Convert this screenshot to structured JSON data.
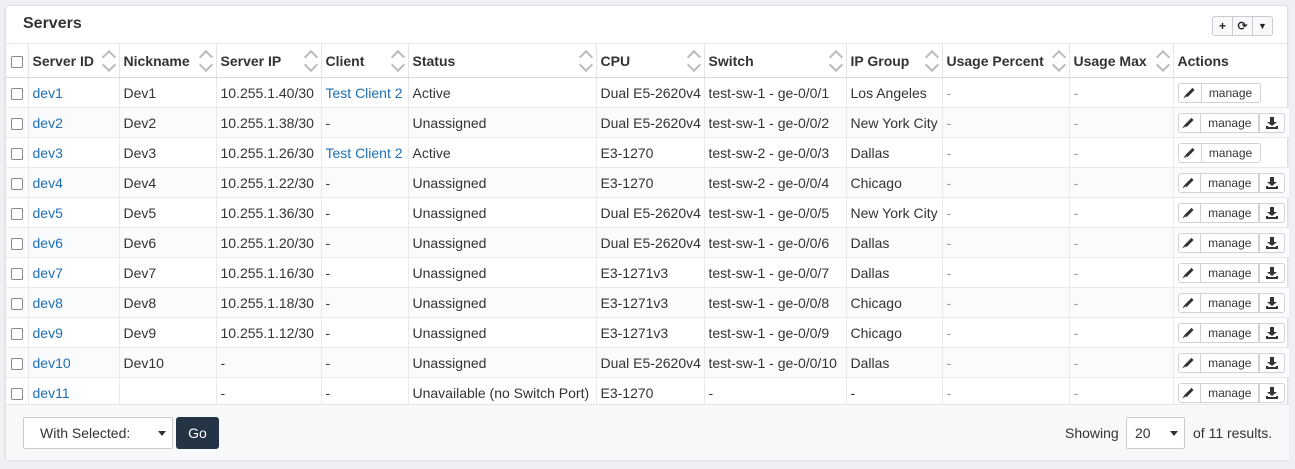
{
  "panel": {
    "title": "Servers"
  },
  "tools": [
    {
      "name": "add-icon",
      "glyph": "+"
    },
    {
      "name": "refresh-icon",
      "glyph": "⟳"
    },
    {
      "name": "filter-icon",
      "glyph": "▼"
    }
  ],
  "columns": [
    "Server ID",
    "Nickname",
    "Server IP",
    "Client",
    "Status",
    "CPU",
    "Switch",
    "IP Group",
    "Usage Percent",
    "Usage Max",
    "Actions"
  ],
  "rows": [
    {
      "id": "dev1",
      "nickname": "Dev1",
      "ip": "10.255.1.40/30",
      "client": "Test Client 2",
      "client_link": true,
      "status": "Active",
      "cpu": "Dual E5-2620v4",
      "switch": "test-sw-1 - ge-0/0/1",
      "ip_group": "Los Angeles",
      "usage_percent": "-",
      "usage_max": "-",
      "download": false
    },
    {
      "id": "dev2",
      "nickname": "Dev2",
      "ip": "10.255.1.38/30",
      "client": "-",
      "client_link": false,
      "status": "Unassigned",
      "cpu": "Dual E5-2620v4",
      "switch": "test-sw-1 - ge-0/0/2",
      "ip_group": "New York City",
      "usage_percent": "-",
      "usage_max": "-",
      "download": true
    },
    {
      "id": "dev3",
      "nickname": "Dev3",
      "ip": "10.255.1.26/30",
      "client": "Test Client 2",
      "client_link": true,
      "status": "Active",
      "cpu": "E3-1270",
      "switch": "test-sw-2 - ge-0/0/3",
      "ip_group": "Dallas",
      "usage_percent": "-",
      "usage_max": "-",
      "download": false
    },
    {
      "id": "dev4",
      "nickname": "Dev4",
      "ip": "10.255.1.22/30",
      "client": "-",
      "client_link": false,
      "status": "Unassigned",
      "cpu": "E3-1270",
      "switch": "test-sw-2 - ge-0/0/4",
      "ip_group": "Chicago",
      "usage_percent": "-",
      "usage_max": "-",
      "download": true
    },
    {
      "id": "dev5",
      "nickname": "Dev5",
      "ip": "10.255.1.36/30",
      "client": "-",
      "client_link": false,
      "status": "Unassigned",
      "cpu": "Dual E5-2620v4",
      "switch": "test-sw-1 - ge-0/0/5",
      "ip_group": "New York City",
      "usage_percent": "-",
      "usage_max": "-",
      "download": true
    },
    {
      "id": "dev6",
      "nickname": "Dev6",
      "ip": "10.255.1.20/30",
      "client": "-",
      "client_link": false,
      "status": "Unassigned",
      "cpu": "Dual E5-2620v4",
      "switch": "test-sw-1 - ge-0/0/6",
      "ip_group": "Dallas",
      "usage_percent": "-",
      "usage_max": "-",
      "download": true
    },
    {
      "id": "dev7",
      "nickname": "Dev7",
      "ip": "10.255.1.16/30",
      "client": "-",
      "client_link": false,
      "status": "Unassigned",
      "cpu": "E3-1271v3",
      "switch": "test-sw-1 - ge-0/0/7",
      "ip_group": "Dallas",
      "usage_percent": "-",
      "usage_max": "-",
      "download": true
    },
    {
      "id": "dev8",
      "nickname": "Dev8",
      "ip": "10.255.1.18/30",
      "client": "-",
      "client_link": false,
      "status": "Unassigned",
      "cpu": "E3-1271v3",
      "switch": "test-sw-1 - ge-0/0/8",
      "ip_group": "Chicago",
      "usage_percent": "-",
      "usage_max": "-",
      "download": true
    },
    {
      "id": "dev9",
      "nickname": "Dev9",
      "ip": "10.255.1.12/30",
      "client": "-",
      "client_link": false,
      "status": "Unassigned",
      "cpu": "E3-1271v3",
      "switch": "test-sw-1 - ge-0/0/9",
      "ip_group": "Chicago",
      "usage_percent": "-",
      "usage_max": "-",
      "download": true
    },
    {
      "id": "dev10",
      "nickname": "Dev10",
      "ip": "-",
      "client": "-",
      "client_link": false,
      "status": "Unassigned",
      "cpu": "Dual E5-2620v4",
      "switch": "test-sw-1 - ge-0/0/10",
      "ip_group": "Dallas",
      "usage_percent": "-",
      "usage_max": "-",
      "download": true
    },
    {
      "id": "dev11",
      "nickname": "",
      "ip": "-",
      "client": "-",
      "client_link": false,
      "status": "Unavailable (no Switch Port)",
      "cpu": "E3-1270",
      "switch": "-",
      "ip_group": "-",
      "usage_percent": "-",
      "usage_max": "-",
      "download": true
    }
  ],
  "actions": {
    "manage_label": "manage"
  },
  "footer": {
    "bulk_select": "With Selected:",
    "go_label": "Go",
    "showing_label": "Showing",
    "page_size": "20",
    "results_label": "of 11 results."
  },
  "colors": {
    "link": "#1f6fb5",
    "go_button": "#253444"
  }
}
